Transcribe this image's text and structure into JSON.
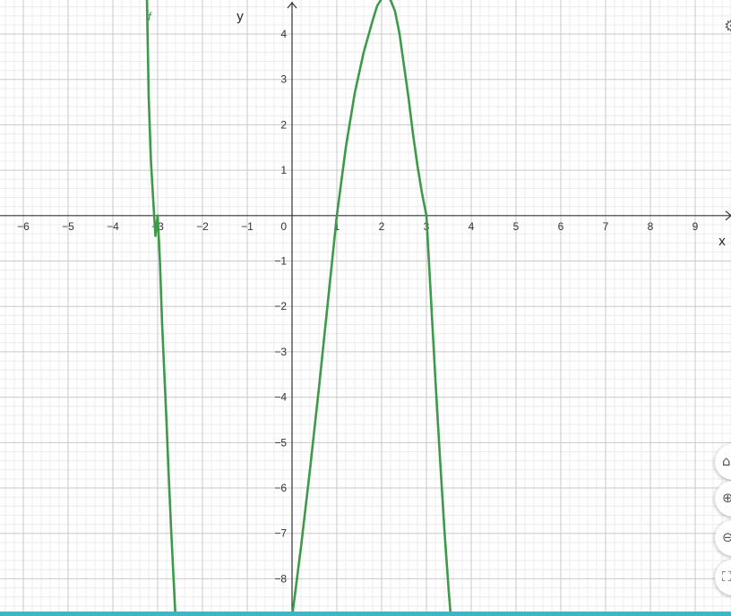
{
  "chart_data": {
    "type": "line",
    "title": "",
    "xlabel": "x",
    "ylabel": "y",
    "xlim": [
      -6.52,
      9.8
    ],
    "ylim": [
      -8.82,
      4.75
    ],
    "x_ticks": [
      "−6",
      "−5",
      "−4",
      "−3",
      "−2",
      "−1",
      "0",
      "1",
      "2",
      "3",
      "4",
      "5",
      "6",
      "7",
      "8",
      "9"
    ],
    "y_ticks": [
      "−8",
      "−7",
      "−6",
      "−5",
      "−4",
      "−3",
      "−2",
      "−1",
      "1",
      "2",
      "3",
      "4"
    ],
    "grid": true,
    "minor_grid": true,
    "legend": "none",
    "series": [
      {
        "name": "f",
        "color": "#3d9a4a",
        "points": [
          [
            -3.24,
            4.8
          ],
          [
            -3.2,
            2.6
          ],
          [
            -3.15,
            1.2
          ],
          [
            -3.1,
            0.35
          ],
          [
            -3.05,
            -0.45
          ],
          [
            -3.0,
            0.0
          ],
          [
            -2.95,
            -1.0
          ],
          [
            -2.9,
            -2.4
          ],
          [
            -2.85,
            -3.5
          ],
          [
            -2.8,
            -4.6
          ],
          [
            -2.75,
            -5.8
          ],
          [
            -2.7,
            -6.9
          ],
          [
            -2.65,
            -7.9
          ],
          [
            -2.6,
            -8.9
          ],
          [
            0.0,
            -8.85
          ],
          [
            0.2,
            -7.3
          ],
          [
            0.4,
            -5.6
          ],
          [
            0.6,
            -3.8
          ],
          [
            0.8,
            -1.9
          ],
          [
            1.0,
            0.0
          ],
          [
            1.2,
            1.5
          ],
          [
            1.4,
            2.7
          ],
          [
            1.6,
            3.6
          ],
          [
            1.8,
            4.3
          ],
          [
            1.9,
            4.62
          ],
          [
            2.0,
            4.78
          ],
          [
            2.1,
            4.82
          ],
          [
            2.2,
            4.75
          ],
          [
            2.3,
            4.5
          ],
          [
            2.4,
            4.0
          ],
          [
            2.5,
            3.3
          ],
          [
            2.6,
            2.6
          ],
          [
            2.7,
            1.8
          ],
          [
            2.8,
            1.1
          ],
          [
            2.9,
            0.5
          ],
          [
            3.0,
            0.0
          ],
          [
            3.1,
            -1.8
          ],
          [
            3.2,
            -3.6
          ],
          [
            3.3,
            -5.3
          ],
          [
            3.4,
            -6.9
          ],
          [
            3.5,
            -8.3
          ],
          [
            3.55,
            -8.9
          ]
        ],
        "segments": [
          [
            0,
            13
          ],
          [
            14,
            41
          ]
        ]
      }
    ]
  },
  "labels": {
    "x_axis_name": "x",
    "y_axis_name": "y",
    "origin": "0",
    "function_name": "f"
  },
  "controls": {
    "home_icon": "home-icon",
    "zoom_in_icon": "zoom-in-icon",
    "zoom_out_icon": "zoom-out-icon",
    "fullscreen_icon": "fullscreen-icon",
    "settings_icon": "gear-icon"
  },
  "colors": {
    "curve": "#3d9a4a",
    "major_grid": "#c9c9c9",
    "minor_grid": "#ececec",
    "axis": "#333333",
    "bottom_strip": "#3fb5c8"
  }
}
